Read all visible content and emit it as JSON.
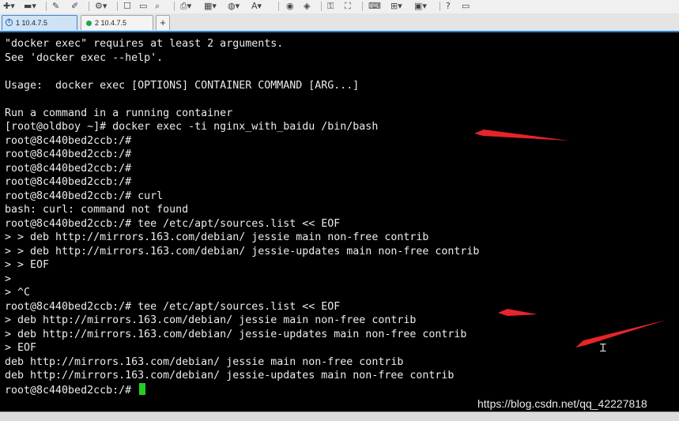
{
  "tabs": [
    {
      "label": "1 10.4.7.5",
      "active": true,
      "icon": "info-icon"
    },
    {
      "label": "2 10.4.7.5",
      "active": false,
      "icon": "connected-dot-icon"
    }
  ],
  "new_tab_label": "+",
  "terminal": {
    "lines": [
      "\"docker exec\" requires at least 2 arguments.",
      "See 'docker exec --help'.",
      "",
      "Usage:  docker exec [OPTIONS] CONTAINER COMMAND [ARG...]",
      "",
      "Run a command in a running container",
      "[root@oldboy ~]# docker exec -ti nginx_with_baidu /bin/bash",
      "root@8c440bed2ccb:/#",
      "root@8c440bed2ccb:/#",
      "root@8c440bed2ccb:/#",
      "root@8c440bed2ccb:/#",
      "root@8c440bed2ccb:/# curl",
      "bash: curl: command not found",
      "root@8c440bed2ccb:/# tee /etc/apt/sources.list << EOF",
      "> > deb http://mirrors.163.com/debian/ jessie main non-free contrib",
      "> > deb http://mirrors.163.com/debian/ jessie-updates main non-free contrib",
      "> > EOF",
      ">",
      "> ^C",
      "root@8c440bed2ccb:/# tee /etc/apt/sources.list << EOF",
      "> deb http://mirrors.163.com/debian/ jessie main non-free contrib",
      "> deb http://mirrors.163.com/debian/ jessie-updates main non-free contrib",
      "> EOF",
      "deb http://mirrors.163.com/debian/ jessie main non-free contrib",
      "deb http://mirrors.163.com/debian/ jessie-updates main non-free contrib",
      "root@8c440bed2ccb:/# "
    ],
    "cursor_color": "#20d020"
  },
  "watermark": "https://blog.csdn.net/qq_42227818",
  "colors": {
    "annotation_arrow": "#e8242a",
    "tab_accent": "#2a7fd4"
  }
}
